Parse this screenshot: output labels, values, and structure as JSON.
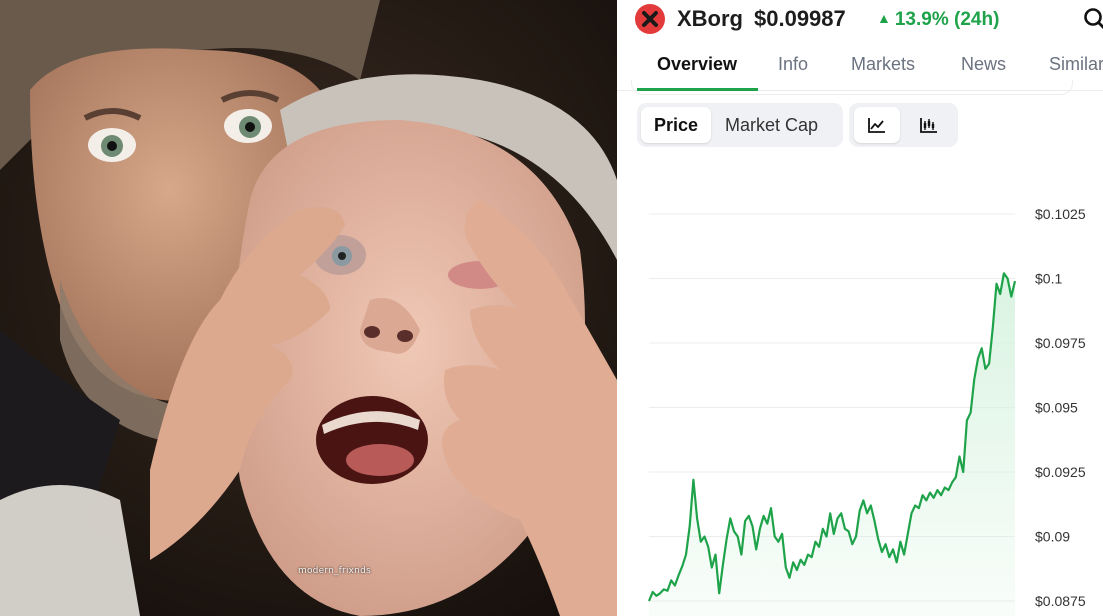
{
  "photo": {
    "watermark": "modern_frixnds"
  },
  "header": {
    "coin_name": "XBorg",
    "coin_price": "$0.09987",
    "price_change": "13.9% (24h)",
    "change_direction_icon": "triangle-up-icon",
    "logo_icon": "x-logo-icon",
    "search_icon": "search-icon"
  },
  "tabs": [
    {
      "label": "Overview",
      "active": true
    },
    {
      "label": "Info",
      "active": false
    },
    {
      "label": "Markets",
      "active": false
    },
    {
      "label": "News",
      "active": false
    },
    {
      "label": "Similar",
      "active": false
    }
  ],
  "toggles": {
    "price_label": "Price",
    "market_cap_label": "Market Cap",
    "selected": "Price",
    "chart_type_selected": "line"
  },
  "colors": {
    "accent_green": "#1fa34a",
    "logo_red": "#e33b3b",
    "area_fill": "#d8f3e0"
  },
  "chart_data": {
    "type": "area",
    "title": "",
    "xlabel": "",
    "ylabel": "",
    "ylim": [
      0.0875,
      0.1025
    ],
    "yticks": [
      "$0.1025",
      "$0.1",
      "$0.0975",
      "$0.095",
      "$0.0925",
      "$0.09",
      "$0.0875"
    ],
    "grid": true,
    "legend": "none",
    "series": [
      {
        "values": [
          0.0875,
          0.08785,
          0.0877,
          0.0878,
          0.08795,
          0.0879,
          0.0883,
          0.0881,
          0.0885,
          0.08885,
          0.0893,
          0.0904,
          0.0922,
          0.0907,
          0.0898,
          0.09,
          0.0896,
          0.0888,
          0.0893,
          0.0878,
          0.0889,
          0.0899,
          0.0907,
          0.0902,
          0.09,
          0.0893,
          0.0906,
          0.0908,
          0.0904,
          0.0895,
          0.0903,
          0.0908,
          0.0905,
          0.0911,
          0.09,
          0.0898,
          0.0901,
          0.0888,
          0.0884,
          0.089,
          0.0887,
          0.0891,
          0.0889,
          0.0893,
          0.0892,
          0.0898,
          0.0896,
          0.0903,
          0.09,
          0.0909,
          0.0901,
          0.0907,
          0.0909,
          0.0903,
          0.0902,
          0.0897,
          0.09,
          0.091,
          0.0914,
          0.0909,
          0.0912,
          0.0906,
          0.0899,
          0.0894,
          0.0897,
          0.0892,
          0.0895,
          0.089,
          0.0898,
          0.0893,
          0.0901,
          0.0909,
          0.0912,
          0.0911,
          0.0916,
          0.0914,
          0.0917,
          0.0915,
          0.0918,
          0.0916,
          0.0919,
          0.0918,
          0.0921,
          0.0923,
          0.0931,
          0.0925,
          0.0945,
          0.0948,
          0.0961,
          0.0969,
          0.0973,
          0.0965,
          0.0967,
          0.0981,
          0.0998,
          0.0994,
          0.1002,
          0.1,
          0.0993,
          0.0999
        ]
      }
    ]
  }
}
